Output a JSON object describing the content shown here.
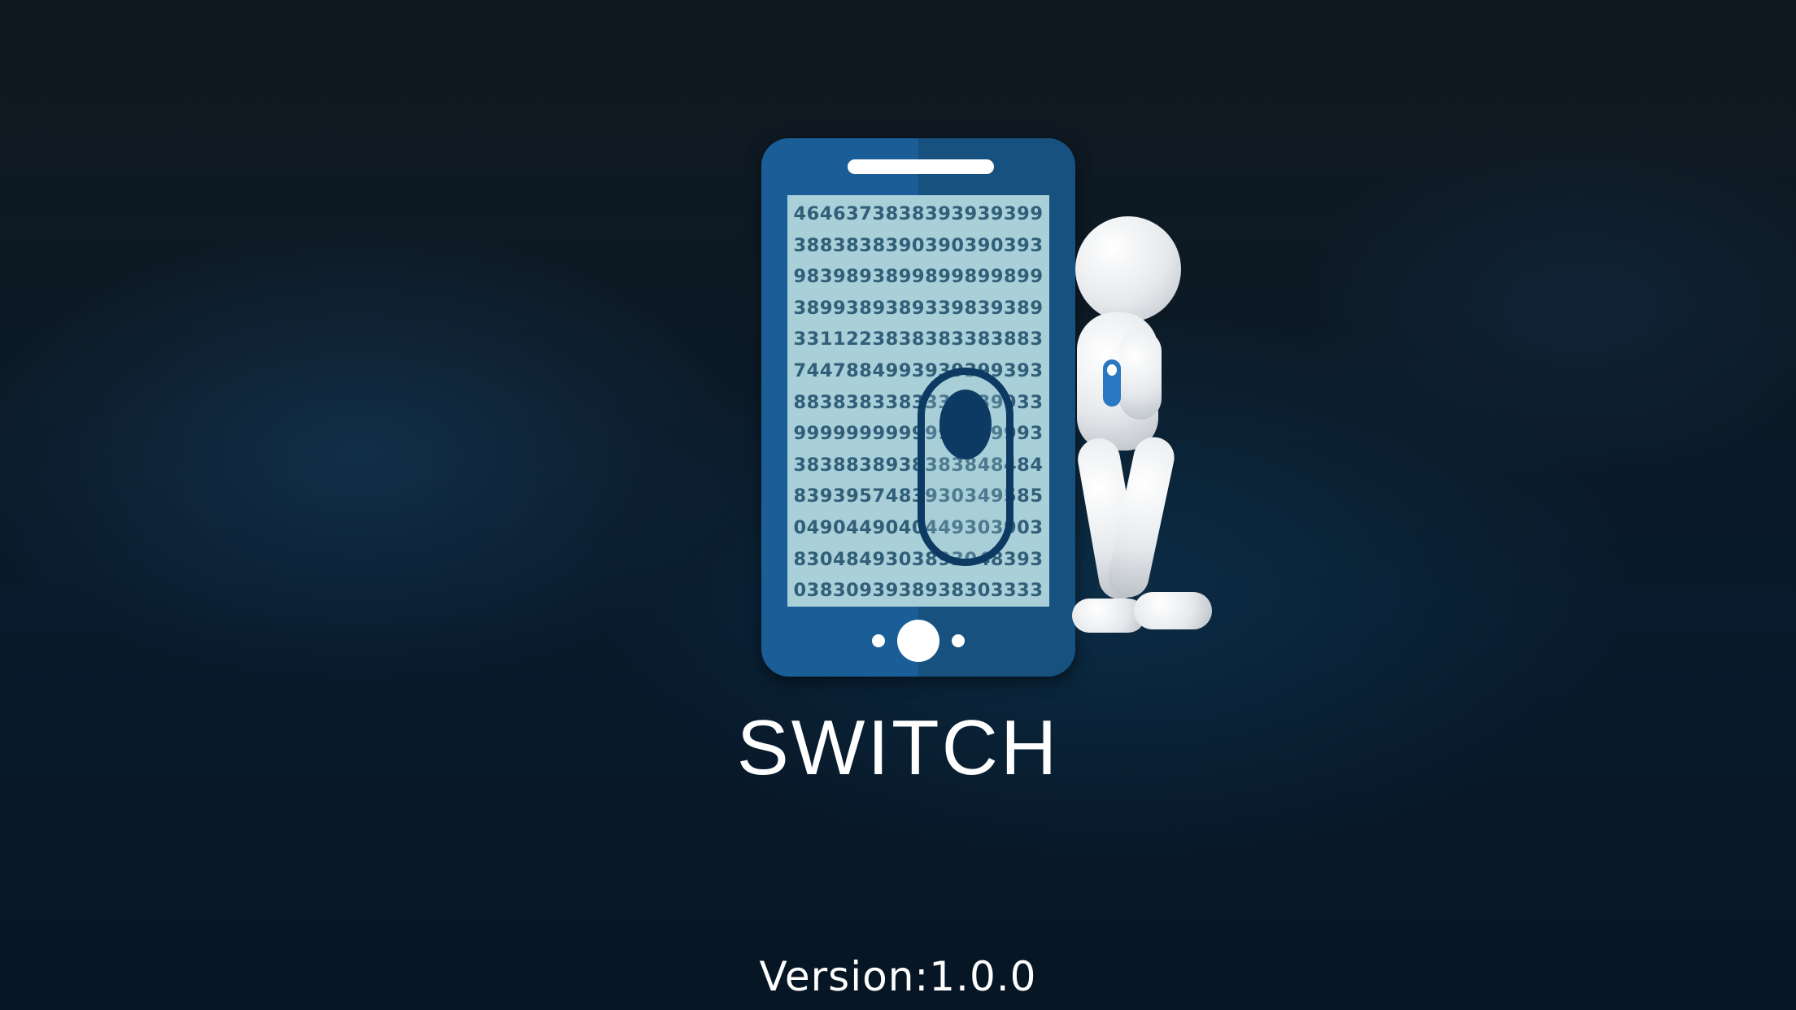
{
  "app": {
    "title": "SWITCH",
    "version": "Version:1.0.0"
  },
  "logo": {
    "screen_digits": [
      "4646373838393939399",
      "3883838390390390393",
      "9839893899899899899",
      "3899389389339839389",
      "3311223838383383883",
      "7447884993939399393",
      "8838383383339939933",
      "9999999999999999993",
      "3838838938383848484",
      "8393957483930349585",
      "0490449040449303903",
      "8304849303893048393",
      "0383093938938303333"
    ]
  },
  "colors": {
    "phone_body": "#1b5e97",
    "phone_screen": "#a9cfd8",
    "toggle": "#0d3a63",
    "text": "#ffffff"
  },
  "icons": {
    "logo": "phone-toggle-icon",
    "mascot": "white-figure-icon"
  }
}
